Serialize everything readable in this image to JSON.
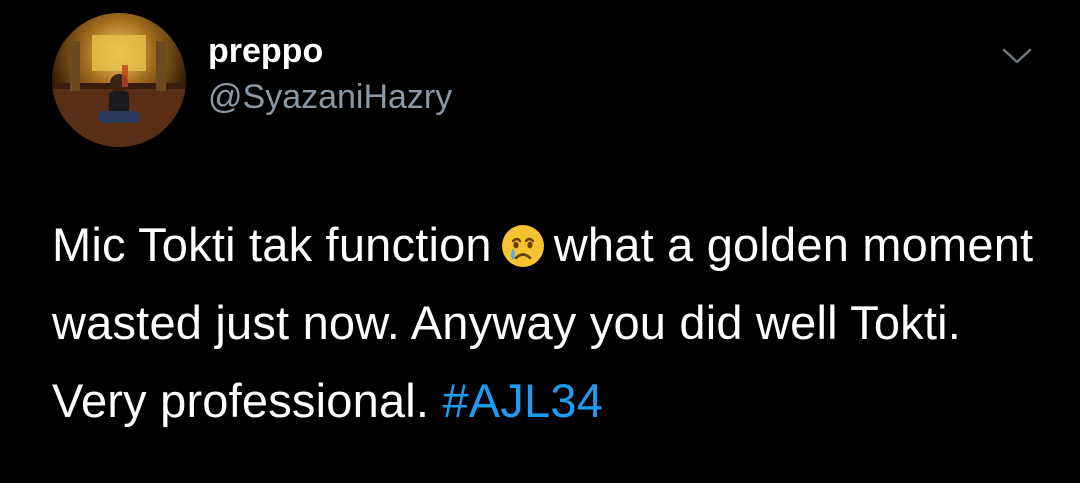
{
  "tweet": {
    "display_name": "preppo",
    "handle": "@SyazaniHazry",
    "text_part1": "Mic Tokti tak function",
    "emoji_name": "crying-face-emoji",
    "text_part2": "what a golden moment wasted just now. Anyway you did well Tokti. Very professional.",
    "hashtag": "#AJL34",
    "menu_icon": "chevron-down-icon"
  },
  "colors": {
    "background": "#000000",
    "text": "#ffffff",
    "secondary_text": "#8b98a5",
    "link": "#1d9bf0"
  }
}
